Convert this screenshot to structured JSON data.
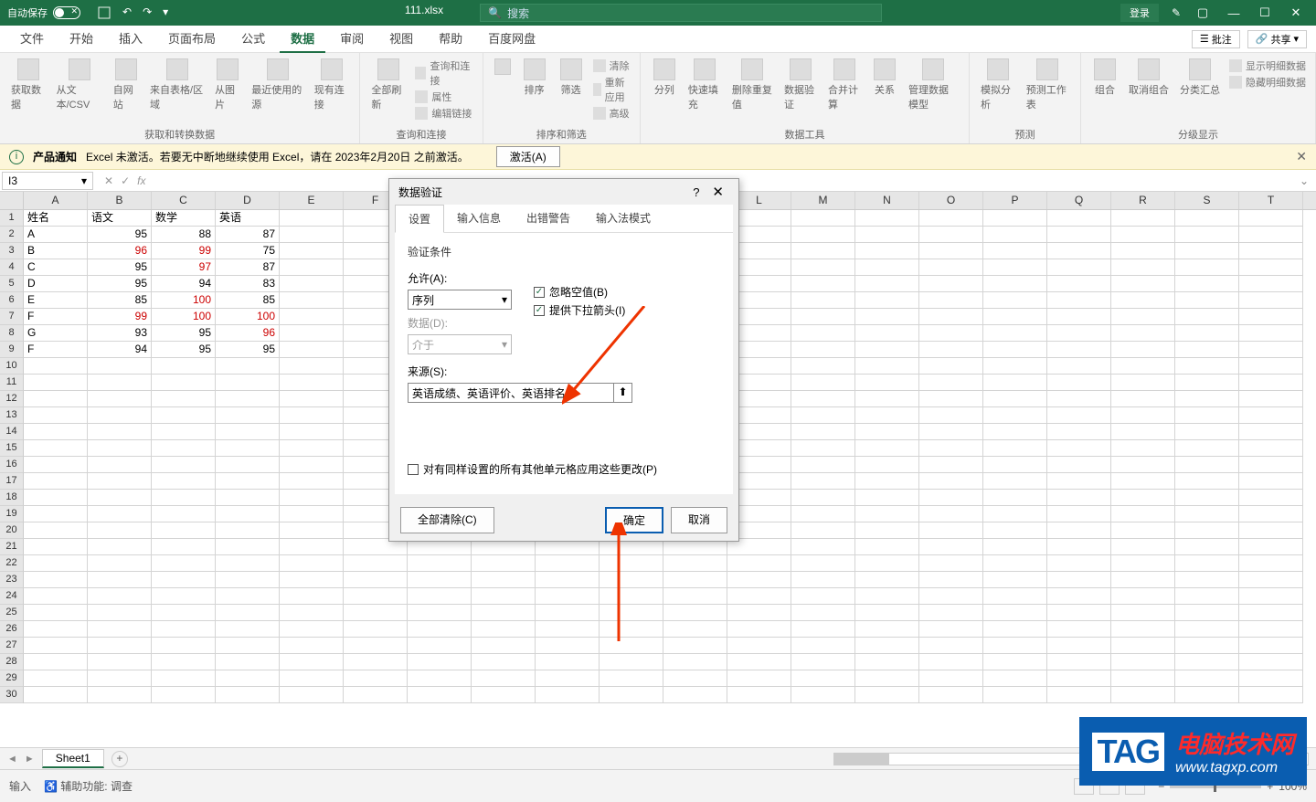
{
  "titlebar": {
    "autosave": "自动保存",
    "filename": "111.xlsx",
    "search_placeholder": "搜索",
    "login": "登录"
  },
  "tabs": {
    "items": [
      "文件",
      "开始",
      "插入",
      "页面布局",
      "公式",
      "数据",
      "审阅",
      "视图",
      "帮助",
      "百度网盘"
    ],
    "active_index": 5,
    "comment": "批注",
    "share": "共享"
  },
  "ribbon": {
    "g1": {
      "label": "获取和转换数据",
      "btns": [
        "获取数据",
        "从文本/CSV",
        "自网站",
        "来自表格/区域",
        "从图片",
        "最近使用的源",
        "现有连接"
      ]
    },
    "g2": {
      "label": "查询和连接",
      "refresh": "全部刷新",
      "items": [
        "查询和连接",
        "属性",
        "编辑链接"
      ]
    },
    "g3": {
      "label": "排序和筛选",
      "sort": "排序",
      "filter": "筛选",
      "items": [
        "清除",
        "重新应用",
        "高级"
      ]
    },
    "g4": {
      "label": "数据工具",
      "btns": [
        "分列",
        "快速填充",
        "删除重复值",
        "数据验证",
        "合并计算",
        "关系",
        "管理数据模型"
      ]
    },
    "g5": {
      "label": "预测",
      "btns": [
        "模拟分析",
        "预测工作表"
      ]
    },
    "g6": {
      "label": "分级显示",
      "btns": [
        "组合",
        "取消组合",
        "分类汇总"
      ],
      "items": [
        "显示明细数据",
        "隐藏明细数据"
      ]
    }
  },
  "notice": {
    "title": "产品通知",
    "text": "Excel 未激活。若要无中断地继续使用 Excel，请在 2023年2月20日 之前激活。",
    "button": "激活(A)"
  },
  "formula": {
    "cell": "I3"
  },
  "headers": [
    "A",
    "B",
    "C",
    "D",
    "E",
    "F",
    "G",
    "H",
    "I",
    "J",
    "K",
    "L",
    "M",
    "N",
    "O",
    "P",
    "Q",
    "R",
    "S",
    "T"
  ],
  "sheet_headers": {
    "A": "姓名",
    "B": "语文",
    "C": "数学",
    "D": "英语"
  },
  "data_rows": [
    {
      "n": "A",
      "c": [
        95,
        88,
        87
      ],
      "red": []
    },
    {
      "n": "B",
      "c": [
        96,
        99,
        75
      ],
      "red": [
        0,
        1
      ]
    },
    {
      "n": "C",
      "c": [
        95,
        97,
        87
      ],
      "red": [
        1
      ]
    },
    {
      "n": "D",
      "c": [
        95,
        94,
        83
      ],
      "red": []
    },
    {
      "n": "E",
      "c": [
        85,
        100,
        85
      ],
      "red": [
        1
      ]
    },
    {
      "n": "F",
      "c": [
        99,
        100,
        100
      ],
      "red": [
        0,
        1,
        2
      ]
    },
    {
      "n": "G",
      "c": [
        93,
        95,
        96
      ],
      "red": [
        2
      ]
    },
    {
      "n": "F",
      "c": [
        94,
        95,
        95
      ],
      "red": []
    }
  ],
  "sheet": {
    "name": "Sheet1"
  },
  "status": {
    "mode": "输入",
    "acc": "辅助功能: 调查",
    "zoom": "100%"
  },
  "dialog": {
    "title": "数据验证",
    "tabs": [
      "设置",
      "输入信息",
      "出错警告",
      "输入法模式"
    ],
    "section": "验证条件",
    "allow_label": "允许(A):",
    "allow_value": "序列",
    "ignore_blank": "忽略空值(B)",
    "dropdown": "提供下拉箭头(I)",
    "data_label": "数据(D):",
    "data_value": "介于",
    "source_label": "来源(S):",
    "source_value": "英语成绩、英语评价、英语排名",
    "apply_all": "对有同样设置的所有其他单元格应用这些更改(P)",
    "clear": "全部清除(C)",
    "ok": "确定",
    "cancel": "取消"
  },
  "watermark": {
    "tag": "TAG",
    "t1": "电脑技术网",
    "t2": "www.tagxp.com"
  }
}
